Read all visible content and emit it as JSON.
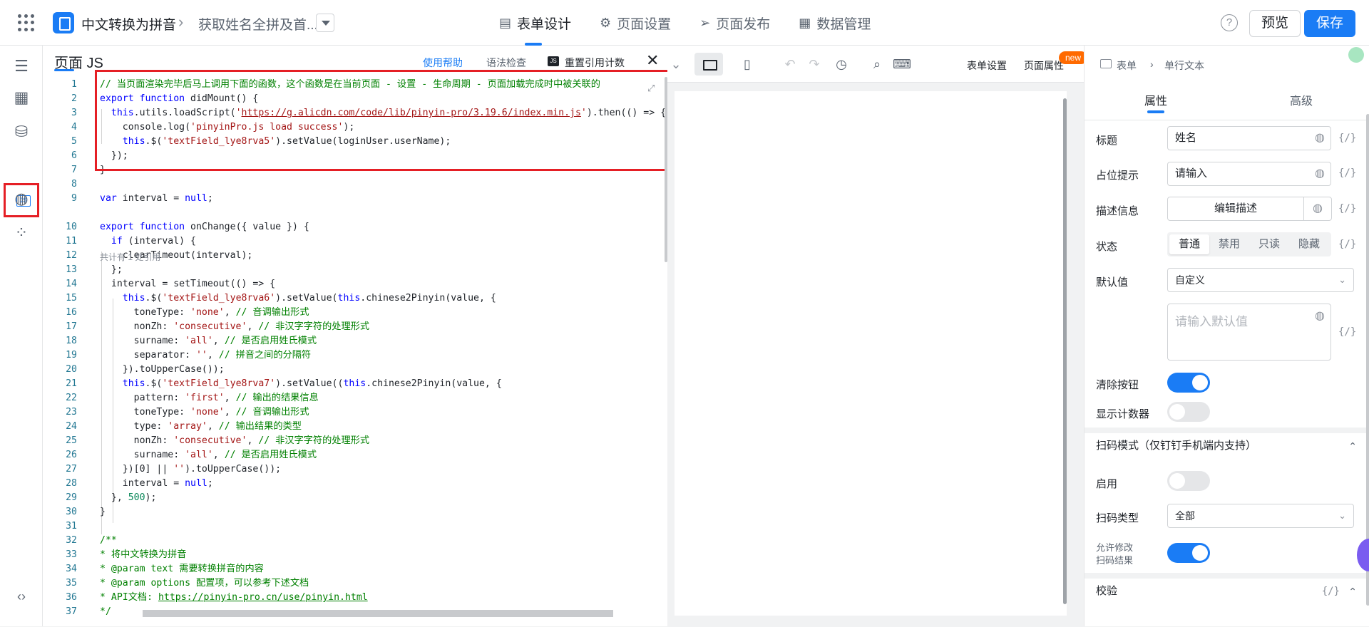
{
  "topbar": {
    "app_name": "中文转换为拼音",
    "form_name": "获取姓名全拼及首...",
    "tabs": [
      {
        "label": "表单设计",
        "icon": "document-icon"
      },
      {
        "label": "页面设置",
        "icon": "gear-icon"
      },
      {
        "label": "页面发布",
        "icon": "send-icon"
      },
      {
        "label": "数据管理",
        "icon": "table-icon"
      }
    ],
    "help_label": "?",
    "preview_label": "预览",
    "save_label": "保存",
    "accent": "#1a7cf5"
  },
  "code_panel": {
    "title": "页面 JS",
    "use_help": "使用帮助",
    "lint": "语法检查",
    "reset_refs": "重置引用计数",
    "reset_icon": "JS",
    "hint": "共计有 1 处引用",
    "lines": [
      {
        "n": "1",
        "parts": [
          [
            "c-comment",
            "// 当页面渲染完毕后马上调用下面的函数，这个函数是在当前页面 - 设置 - 生命周期 - 页面加载完成时中被关联的"
          ]
        ]
      },
      {
        "n": "2",
        "parts": [
          [
            "c-kw",
            "export function "
          ],
          [
            "",
            "didMount() {"
          ]
        ]
      },
      {
        "n": "3",
        "parts": [
          [
            "",
            "  "
          ],
          [
            "c-kw",
            "this"
          ],
          [
            "",
            ".utils.loadScript("
          ],
          [
            "c-str",
            "'"
          ],
          [
            "c-url",
            "https://g.alicdn.com/code/lib/pinyin-pro/3.19.6/index.min.js"
          ],
          [
            "c-str",
            "'"
          ],
          [
            "",
            ").then(() => {"
          ]
        ]
      },
      {
        "n": "4",
        "parts": [
          [
            "",
            "    console.log("
          ],
          [
            "c-str",
            "'pinyinPro.js load success'"
          ],
          [
            "",
            ");"
          ]
        ]
      },
      {
        "n": "5",
        "parts": [
          [
            "",
            "    "
          ],
          [
            "c-kw",
            "this"
          ],
          [
            "",
            ".$("
          ],
          [
            "c-str",
            "'textField_lye8rva5'"
          ],
          [
            "",
            ").setValue(loginUser.userName);"
          ]
        ]
      },
      {
        "n": "6",
        "parts": [
          [
            "",
            "  });"
          ]
        ]
      },
      {
        "n": "7",
        "parts": [
          [
            "",
            "}"
          ]
        ]
      },
      {
        "n": "8",
        "parts": [
          [
            "",
            ""
          ]
        ]
      },
      {
        "n": "9",
        "parts": [
          [
            "c-kw",
            "var "
          ],
          [
            "",
            "interval = "
          ],
          [
            "c-kw",
            "null"
          ],
          [
            "",
            ";"
          ]
        ]
      },
      {
        "n": "10",
        "parts": [
          [
            "c-kw",
            "export function "
          ],
          [
            "",
            "onChange({ value }) {"
          ]
        ]
      },
      {
        "n": "11",
        "parts": [
          [
            "",
            "  "
          ],
          [
            "c-kw",
            "if "
          ],
          [
            "",
            "(interval) {"
          ]
        ]
      },
      {
        "n": "12",
        "parts": [
          [
            "",
            "    clearTimeout(interval);"
          ]
        ]
      },
      {
        "n": "13",
        "parts": [
          [
            "",
            "  };"
          ]
        ]
      },
      {
        "n": "14",
        "parts": [
          [
            "",
            "  interval = setTimeout(() => {"
          ]
        ]
      },
      {
        "n": "15",
        "parts": [
          [
            "",
            "    "
          ],
          [
            "c-kw",
            "this"
          ],
          [
            "",
            ".$("
          ],
          [
            "c-str",
            "'textField_lye8rva6'"
          ],
          [
            "",
            ").setValue("
          ],
          [
            "c-kw",
            "this"
          ],
          [
            "",
            ".chinese2Pinyin(value, {"
          ]
        ]
      },
      {
        "n": "16",
        "parts": [
          [
            "",
            "      toneType: "
          ],
          [
            "c-str",
            "'none'"
          ],
          [
            "",
            ", "
          ],
          [
            "c-comment",
            "// 音调输出形式"
          ]
        ]
      },
      {
        "n": "17",
        "parts": [
          [
            "",
            "      nonZh: "
          ],
          [
            "c-str",
            "'consecutive'"
          ],
          [
            "",
            ", "
          ],
          [
            "c-comment",
            "// 非汉字字符的处理形式"
          ]
        ]
      },
      {
        "n": "18",
        "parts": [
          [
            "",
            "      surname: "
          ],
          [
            "c-str",
            "'all'"
          ],
          [
            "",
            ", "
          ],
          [
            "c-comment",
            "// 是否启用姓氏模式"
          ]
        ]
      },
      {
        "n": "19",
        "parts": [
          [
            "",
            "      separator: "
          ],
          [
            "c-str",
            "''"
          ],
          [
            "",
            ", "
          ],
          [
            "c-comment",
            "// 拼音之间的分隔符"
          ]
        ]
      },
      {
        "n": "20",
        "parts": [
          [
            "",
            "    }).toUpperCase());"
          ]
        ]
      },
      {
        "n": "21",
        "parts": [
          [
            "",
            "    "
          ],
          [
            "c-kw",
            "this"
          ],
          [
            "",
            ".$("
          ],
          [
            "c-str",
            "'textField_lye8rva7'"
          ],
          [
            "",
            ").setValue(("
          ],
          [
            "c-kw",
            "this"
          ],
          [
            "",
            ".chinese2Pinyin(value, {"
          ]
        ]
      },
      {
        "n": "22",
        "parts": [
          [
            "",
            "      pattern: "
          ],
          [
            "c-str",
            "'first'"
          ],
          [
            "",
            ", "
          ],
          [
            "c-comment",
            "// 输出的结果信息"
          ]
        ]
      },
      {
        "n": "23",
        "parts": [
          [
            "",
            "      toneType: "
          ],
          [
            "c-str",
            "'none'"
          ],
          [
            "",
            ", "
          ],
          [
            "c-comment",
            "// 音调输出形式"
          ]
        ]
      },
      {
        "n": "24",
        "parts": [
          [
            "",
            "      type: "
          ],
          [
            "c-str",
            "'array'"
          ],
          [
            "",
            ", "
          ],
          [
            "c-comment",
            "// 输出结果的类型"
          ]
        ]
      },
      {
        "n": "25",
        "parts": [
          [
            "",
            "      nonZh: "
          ],
          [
            "c-str",
            "'consecutive'"
          ],
          [
            "",
            ", "
          ],
          [
            "c-comment",
            "// 非汉字字符的处理形式"
          ]
        ]
      },
      {
        "n": "26",
        "parts": [
          [
            "",
            "      surname: "
          ],
          [
            "c-str",
            "'all'"
          ],
          [
            "",
            ", "
          ],
          [
            "c-comment",
            "// 是否启用姓氏模式"
          ]
        ]
      },
      {
        "n": "27",
        "parts": [
          [
            "",
            "    })[0] || "
          ],
          [
            "c-str",
            "''"
          ],
          [
            "",
            ").toUpperCase());"
          ]
        ]
      },
      {
        "n": "28",
        "parts": [
          [
            "",
            "    interval = "
          ],
          [
            "c-kw",
            "null"
          ],
          [
            "",
            ";"
          ]
        ]
      },
      {
        "n": "29",
        "parts": [
          [
            "",
            "  }, "
          ],
          [
            "c-num",
            "500"
          ],
          [
            "",
            ");"
          ]
        ]
      },
      {
        "n": "30",
        "parts": [
          [
            "",
            "}"
          ]
        ]
      },
      {
        "n": "31",
        "parts": [
          [
            "",
            ""
          ]
        ]
      },
      {
        "n": "32",
        "parts": [
          [
            "c-comment",
            "/**"
          ]
        ]
      },
      {
        "n": "33",
        "parts": [
          [
            "c-comment",
            "* 将中文转换为拼音"
          ]
        ]
      },
      {
        "n": "34",
        "parts": [
          [
            "c-comment",
            "* @param text 需要转换拼音的内容"
          ]
        ]
      },
      {
        "n": "35",
        "parts": [
          [
            "c-comment",
            "* @param options 配置项，可以参考下述文档"
          ]
        ]
      },
      {
        "n": "36",
        "parts": [
          [
            "c-comment",
            "* API文档: "
          ],
          [
            "c-comurl",
            "https://pinyin-pro.cn/use/pinyin.html"
          ]
        ]
      },
      {
        "n": "37",
        "parts": [
          [
            "c-comment",
            "*/"
          ]
        ]
      }
    ]
  },
  "toolbar": {
    "form_settings": "表单设置",
    "page_props": "页面属性",
    "new_badge": "new"
  },
  "props": {
    "crumb_root": "表单",
    "crumb_leaf": "单行文本",
    "tab_props": "属性",
    "tab_advanced": "高级",
    "title_label": "标题",
    "title_value": "姓名",
    "placeholder_label": "占位提示",
    "placeholder_value": "请输入",
    "desc_label": "描述信息",
    "desc_button": "编辑描述",
    "state_label": "状态",
    "state_options": [
      "普通",
      "禁用",
      "只读",
      "隐藏"
    ],
    "state_selected": "普通",
    "default_label": "默认值",
    "default_mode": "自定义",
    "default_placeholder": "请输入默认值",
    "clear_label": "清除按钮",
    "clear_on": true,
    "counter_label": "显示计数器",
    "counter_on": false,
    "scan_section": "扫码模式（仅钉钉手机端内支持）",
    "enable_label": "启用",
    "enable_on": false,
    "scan_type_label": "扫码类型",
    "scan_type_value": "全部",
    "allow_edit_label_1": "允许修改",
    "allow_edit_label_2": "扫码结果",
    "allow_edit_on": true,
    "validate_section": "校验",
    "fx": "{/}"
  }
}
